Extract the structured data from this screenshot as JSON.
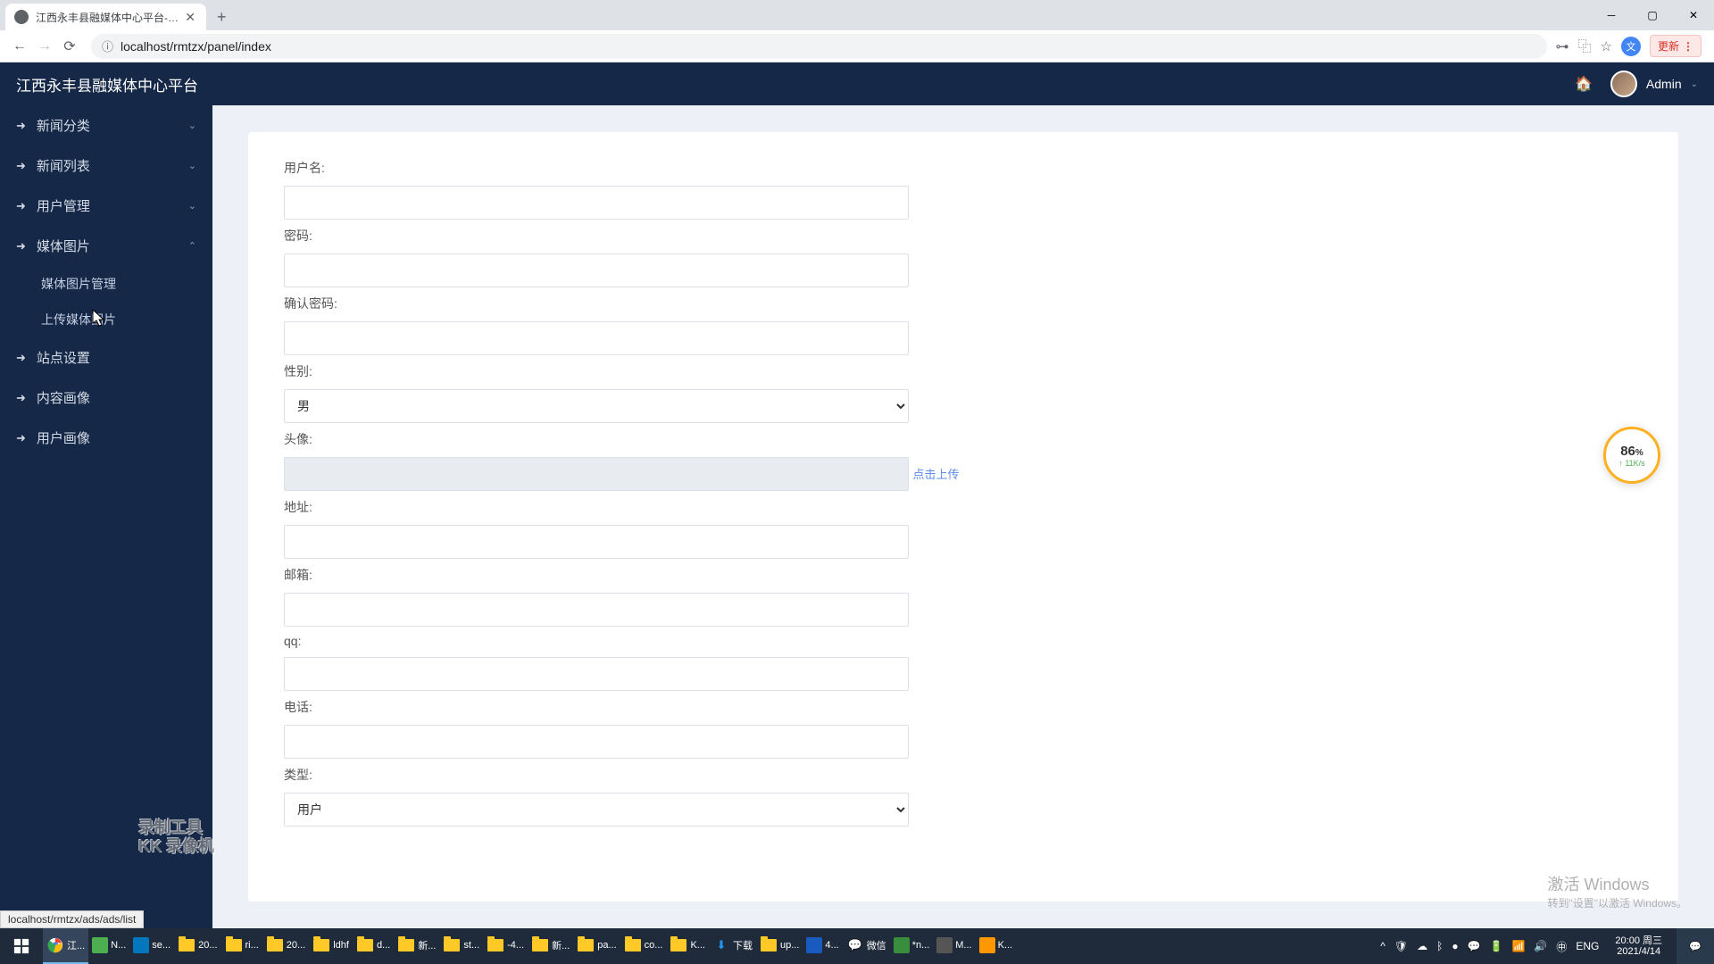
{
  "browser": {
    "tab_title": "江西永丰县融媒体中心平台-管理",
    "url": "localhost/rmtzx/panel/index",
    "update_label": "更新",
    "status_link": "localhost/rmtzx/ads/ads/list"
  },
  "header": {
    "title": "江西永丰县融媒体中心平台",
    "user": "Admin"
  },
  "sidebar": {
    "items": [
      {
        "label": "新闻分类",
        "expandable": true,
        "expanded": false
      },
      {
        "label": "新闻列表",
        "expandable": true,
        "expanded": false
      },
      {
        "label": "用户管理",
        "expandable": true,
        "expanded": false
      },
      {
        "label": "媒体图片",
        "expandable": true,
        "expanded": true,
        "children": [
          {
            "label": "媒体图片管理"
          },
          {
            "label": "上传媒体图片"
          }
        ]
      },
      {
        "label": "站点设置",
        "expandable": false
      },
      {
        "label": "内容画像",
        "expandable": false
      },
      {
        "label": "用户画像",
        "expandable": false
      }
    ]
  },
  "form": {
    "username_label": "用户名:",
    "password_label": "密码:",
    "confirm_password_label": "确认密码:",
    "gender_label": "性别:",
    "gender_value": "男",
    "avatar_label": "头像:",
    "upload_link": "点击上传",
    "address_label": "地址:",
    "email_label": "邮箱:",
    "qq_label": "qq:",
    "phone_label": "电话:",
    "type_label": "类型:",
    "type_value": "用户"
  },
  "speed_widget": {
    "percent": "86",
    "percent_suffix": "%",
    "rate": "↑ 11K/s"
  },
  "watermark": {
    "line1": "录制工具",
    "line2": "KK 录像机"
  },
  "windows_activate": {
    "line1": "激活 Windows",
    "line2": "转到\"设置\"以激活 Windows。"
  },
  "taskbar": {
    "items": [
      {
        "label": "江...",
        "color": "#fff",
        "icon": "chrome"
      },
      {
        "label": "N...",
        "color": "#4caf50",
        "icon": "app"
      },
      {
        "label": "se...",
        "color": "#0277bd",
        "icon": "vscode"
      },
      {
        "label": "20...",
        "icon": "folder"
      },
      {
        "label": "ri...",
        "icon": "folder"
      },
      {
        "label": "20...",
        "icon": "folder"
      },
      {
        "label": "ldhf",
        "icon": "folder"
      },
      {
        "label": "d...",
        "icon": "folder"
      },
      {
        "label": "新...",
        "icon": "folder"
      },
      {
        "label": "st...",
        "icon": "folder"
      },
      {
        "label": "-4...",
        "icon": "folder"
      },
      {
        "label": "新...",
        "icon": "folder"
      },
      {
        "label": "pa...",
        "icon": "folder"
      },
      {
        "label": "co...",
        "icon": "folder"
      },
      {
        "label": "K...",
        "icon": "folder"
      },
      {
        "label": "下载",
        "color": "#2196f3",
        "icon": "download"
      },
      {
        "label": "up...",
        "icon": "folder"
      },
      {
        "label": "4...",
        "color": "#185abd",
        "icon": "visio"
      },
      {
        "label": "微信",
        "color": "#07c160",
        "icon": "wechat"
      },
      {
        "label": "*n...",
        "color": "#388e3c",
        "icon": "notepad"
      },
      {
        "label": "M...",
        "color": "#555",
        "icon": "app"
      },
      {
        "label": "K...",
        "color": "#ff9800",
        "icon": "kk"
      }
    ],
    "tray_lang": "ENG",
    "clock_time": "20:00 周三",
    "clock_date": "2021/4/14"
  }
}
